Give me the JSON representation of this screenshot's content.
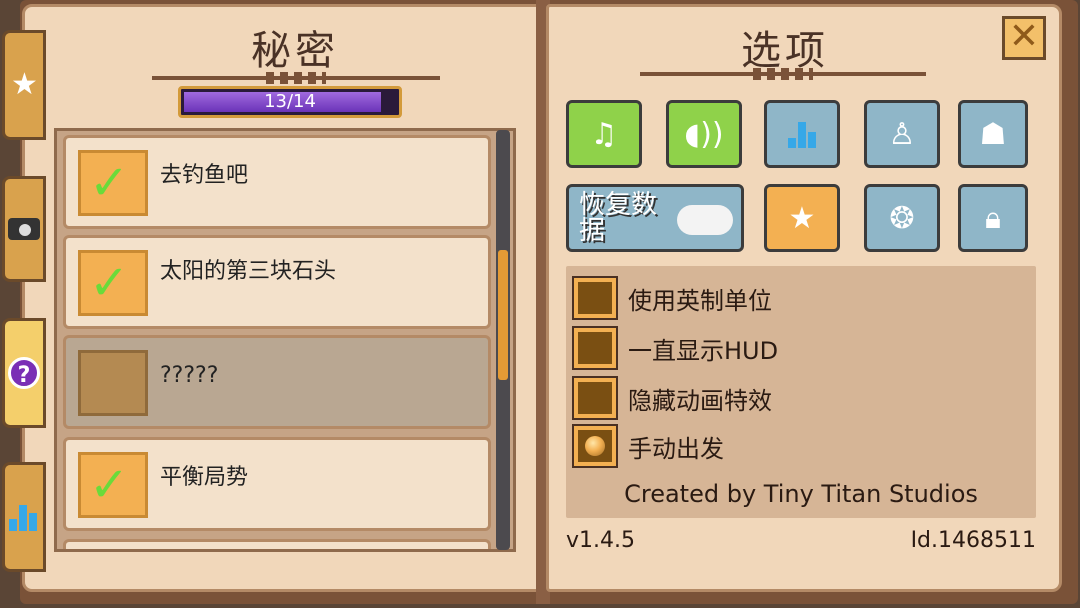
{
  "left_page": {
    "title": "秘密",
    "progress": {
      "text": "13/14",
      "value": 0.93
    },
    "secrets": [
      {
        "label": "去钓鱼吧",
        "completed": true
      },
      {
        "label": "太阳的第三块石头",
        "completed": true
      },
      {
        "label": "?????",
        "completed": false
      },
      {
        "label": "平衡局势",
        "completed": true
      }
    ]
  },
  "side_tabs": [
    {
      "icon": "star-icon"
    },
    {
      "icon": "camera-icon"
    },
    {
      "icon": "question-icon"
    },
    {
      "icon": "bar-chart-icon"
    }
  ],
  "right_page": {
    "title": "选项",
    "close_label": "✕",
    "buttons_row1": [
      "music-icon",
      "sound-icon",
      "stats-icon",
      "stamp-icon",
      "chat-person-icon"
    ],
    "restore_label": "恢复数据",
    "buttons_row2": [
      "star-icon",
      "speech-bubble-icon",
      "lock-icon"
    ],
    "settings": [
      {
        "label": "使用英制单位",
        "checked": false
      },
      {
        "label": "一直显示HUD",
        "checked": false
      },
      {
        "label": "隐藏动画特效",
        "checked": false
      },
      {
        "label": "手动出发",
        "checked": true
      }
    ],
    "credits": "Created by Tiny Titan Studios",
    "version": "v1.4.5",
    "player_id": "Id.1468511"
  },
  "colors": {
    "page": "#f1d7ba",
    "progress_fill": "#7a3cd0",
    "check_green": "#6adb3a",
    "button_green": "#8fd24a",
    "button_blue": "#8fb6c8",
    "button_orange": "#f3b052"
  }
}
